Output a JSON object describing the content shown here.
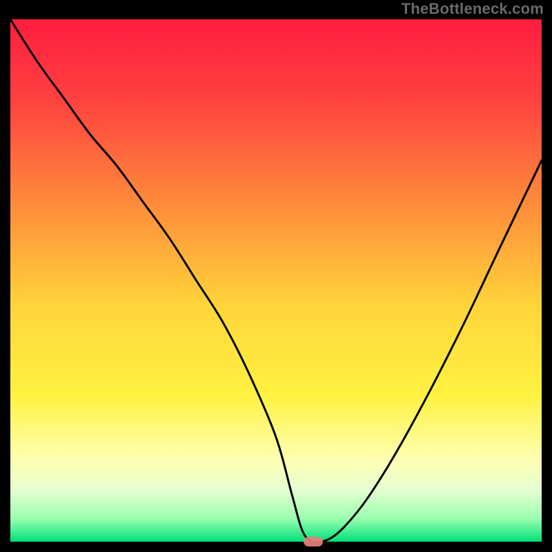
{
  "watermark": {
    "text": "TheBottleneck.com"
  },
  "colors": {
    "gradient_stops": [
      {
        "offset": 0.0,
        "color": "#ff1d3f"
      },
      {
        "offset": 0.15,
        "color": "#ff4040"
      },
      {
        "offset": 0.35,
        "color": "#ff8a3a"
      },
      {
        "offset": 0.55,
        "color": "#ffd53a"
      },
      {
        "offset": 0.72,
        "color": "#fff241"
      },
      {
        "offset": 0.84,
        "color": "#ffffb0"
      },
      {
        "offset": 0.9,
        "color": "#e6ffd0"
      },
      {
        "offset": 0.955,
        "color": "#9cffb0"
      },
      {
        "offset": 1.0,
        "color": "#00e07a"
      }
    ],
    "curve": "#000000",
    "marker": "#e77e7b",
    "frame": "#000000"
  },
  "chart_data": {
    "type": "line",
    "title": "",
    "xlabel": "",
    "ylabel": "",
    "xlim": [
      0,
      100
    ],
    "ylim": [
      0,
      100
    ],
    "minimum_marker": {
      "x": 57,
      "y": 0
    },
    "series": [
      {
        "name": "bottleneck-curve",
        "x": [
          0,
          5,
          10,
          15,
          20,
          25,
          30,
          35,
          40,
          45,
          50,
          53,
          55,
          57,
          60,
          63,
          67,
          72,
          78,
          85,
          92,
          100
        ],
        "y": [
          100,
          92,
          85,
          78,
          72,
          65,
          58,
          50,
          42,
          32,
          20,
          9,
          2,
          0,
          0.5,
          3,
          8,
          16,
          27,
          41,
          56,
          73
        ]
      }
    ]
  }
}
